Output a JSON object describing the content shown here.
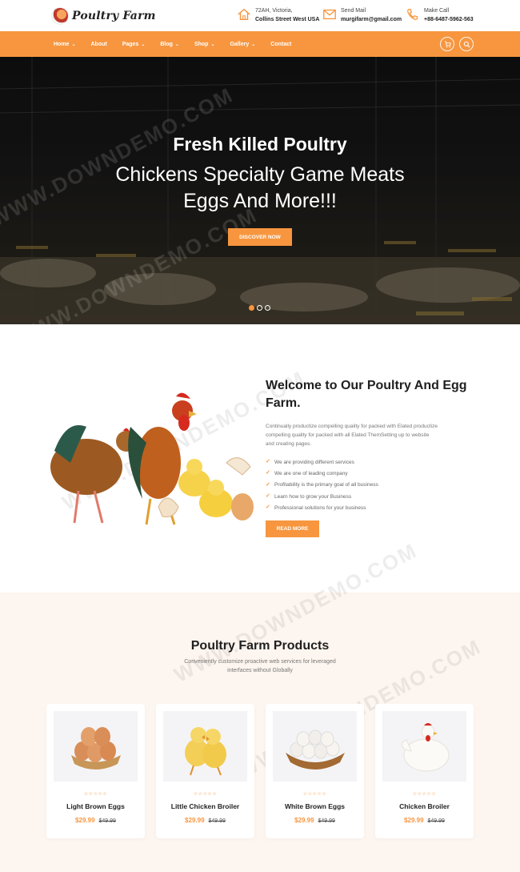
{
  "brand": {
    "name": "Poultry Farm"
  },
  "contact": {
    "address": {
      "line1": "72AH, Victoria,",
      "line2": "Collins Street West USA",
      "icon": "home-icon"
    },
    "mail": {
      "label": "Send Mail",
      "value": "murgifarm@gmail.com",
      "icon": "mail-icon"
    },
    "phone": {
      "label": "Make Call",
      "value": "+88-6487-5962-563",
      "icon": "phone-icon"
    }
  },
  "nav": {
    "items": [
      {
        "label": "Home",
        "has_dropdown": true
      },
      {
        "label": "About",
        "has_dropdown": false
      },
      {
        "label": "Pages",
        "has_dropdown": true
      },
      {
        "label": "Blog",
        "has_dropdown": true
      },
      {
        "label": "Shop",
        "has_dropdown": true
      },
      {
        "label": "Gallery",
        "has_dropdown": true
      },
      {
        "label": "Contact",
        "has_dropdown": false
      }
    ],
    "cart_icon": "cart-icon",
    "search_icon": "search-icon",
    "background": "#f7963f"
  },
  "hero": {
    "title": "Fresh Killed Poultry",
    "subtitle_line1": "Chickens Specialty Game Meats",
    "subtitle_line2": "Eggs And More!!!",
    "button": "DISCOVER NOW",
    "slide_count": 3,
    "active_slide": 1
  },
  "about": {
    "title": "Welcome to Our Poultry And Egg Farm.",
    "description": "Continually productize compelling quality for packed with Elated productize compelling quality for packed with all Elated ThemSetting up to website and creating pages.",
    "features": [
      "We are providing different services",
      "We are one of leading company",
      "Profitability is the primary goal of all business",
      "Learn how to grow your Business",
      "Professional solutions for your business"
    ],
    "button": "READ MORE"
  },
  "products": {
    "title": "Poultry Farm Products",
    "subtitle_line1": "Conveniently customize proactive web services for leveraged",
    "subtitle_line2": "interfaces without Globally",
    "items": [
      {
        "name": "Light Brown Eggs",
        "price": "$29.99",
        "old_price": "$49.99",
        "rating": 0,
        "image": "brown-eggs-basket"
      },
      {
        "name": "Little Chicken Broiler",
        "price": "$29.99",
        "old_price": "$49.99",
        "rating": 0,
        "image": "two-chicks"
      },
      {
        "name": "White Brown Eggs",
        "price": "$29.99",
        "old_price": "$49.99",
        "rating": 0,
        "image": "white-eggs-basket"
      },
      {
        "name": "Chicken Broiler",
        "price": "$29.99",
        "old_price": "$49.99",
        "rating": 0,
        "image": "white-hen"
      }
    ]
  },
  "watermark": "WWW.DOWNDEMO.COM",
  "accent_color": "#f7963f"
}
